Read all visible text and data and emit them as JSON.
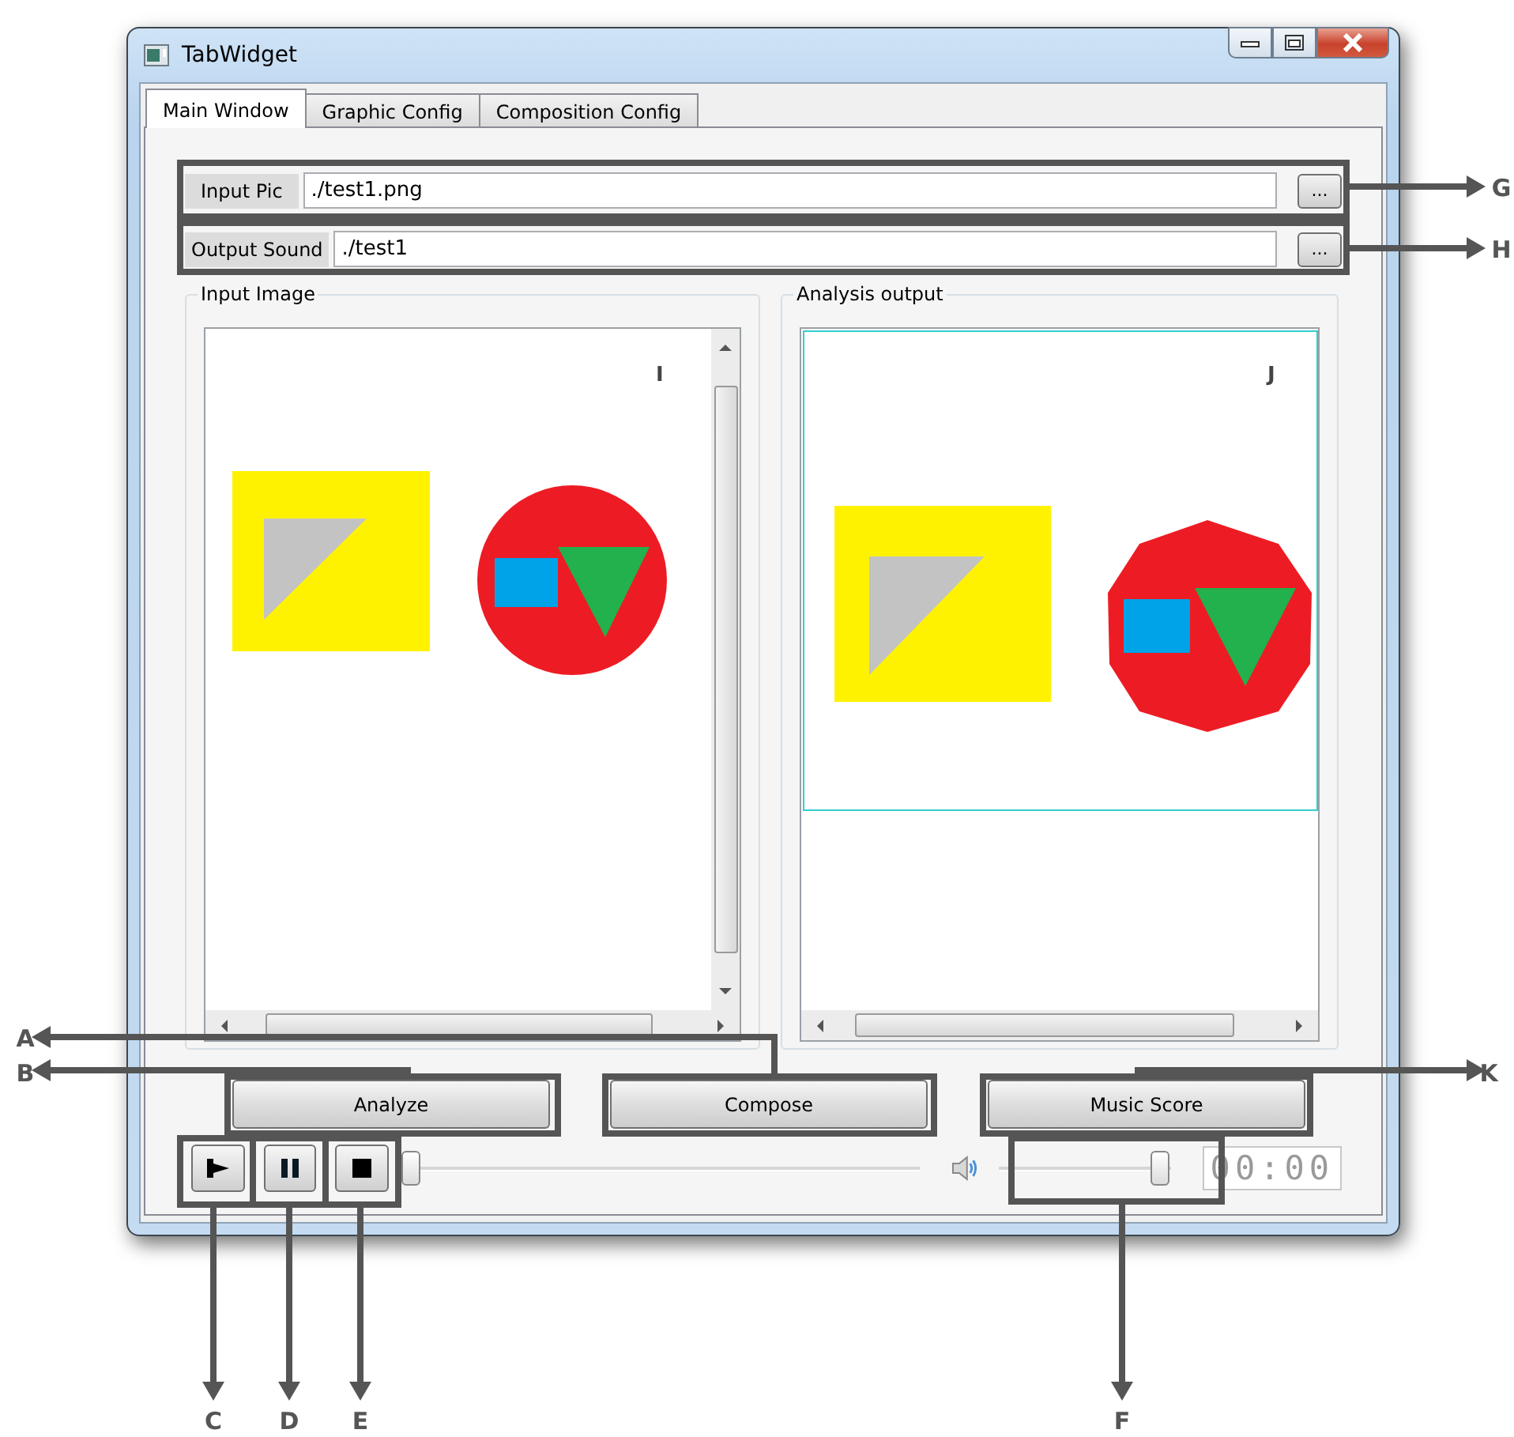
{
  "window": {
    "title": "TabWidget"
  },
  "tabs": [
    {
      "label": "Main Window",
      "selected": true
    },
    {
      "label": "Graphic Config",
      "selected": false
    },
    {
      "label": "Composition Config",
      "selected": false
    }
  ],
  "file_rows": [
    {
      "label": "Input Pic",
      "value": "./test1.png",
      "button": "..."
    },
    {
      "label": "Output Sound",
      "value": "./test1",
      "button": "..."
    }
  ],
  "panels": [
    {
      "title": "Input Image",
      "corner_label": "I"
    },
    {
      "title": "Analysis output",
      "corner_label": "J"
    }
  ],
  "buttons": [
    "Analyze",
    "Compose",
    "Music Score"
  ],
  "player": {
    "seek": {
      "level": 0
    },
    "volume": {
      "level": 0.95
    },
    "time": "00:00"
  },
  "callouts": [
    {
      "letter": "G"
    },
    {
      "letter": "H"
    },
    {
      "letter": "A"
    },
    {
      "letter": "B"
    },
    {
      "letter": "K"
    },
    {
      "letter": "C"
    },
    {
      "letter": "D"
    },
    {
      "letter": "E"
    },
    {
      "letter": "F"
    }
  ]
}
